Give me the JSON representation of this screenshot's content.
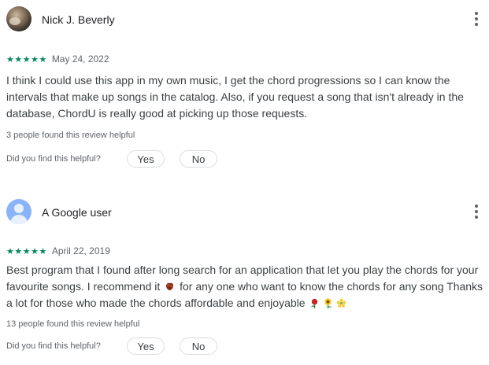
{
  "reviews": [
    {
      "author": "Nick J. Beverly",
      "avatar": "profile-photo",
      "rating": "★★★★★",
      "rating_value": 5,
      "date": "May 24, 2022",
      "text": "I think I could use this app in my own music, I get the chord progressions so I can know the intervals that make up songs in the catalog. Also, if you request a song that isn't already in the database, ChordU is really good at picking up those requests.",
      "helpful_count": "3 people found this review helpful",
      "feedback_question": "Did you find this helpful?",
      "yes_label": "Yes",
      "no_label": "No",
      "menu_icon": "more-vert-icon"
    },
    {
      "author": "A Google user",
      "avatar": "generic-user-icon",
      "rating": "★★★★★",
      "rating_value": 5,
      "date": "April 22, 2019",
      "text_part1": "Best program that I found after long search for an application that let you play the chords for your favourite songs. I recommend it",
      "text_part2": "for any one who want to know the chords for any song Thanks a lot for those who made the chords affordable and enjoyable",
      "emojis": [
        "bouquet-emoji",
        "rose-emoji",
        "sunflower-emoji",
        "blossom-emoji"
      ],
      "helpful_count": "13 people found this review helpful",
      "feedback_question": "Did you find this helpful?",
      "yes_label": "Yes",
      "no_label": "No",
      "menu_icon": "more-vert-icon"
    }
  ],
  "colors": {
    "star": "#01875f",
    "text": "#3c4043",
    "secondary_text": "#5f6368",
    "border": "#dadce0",
    "avatar_generic": "#8ab4f8"
  }
}
